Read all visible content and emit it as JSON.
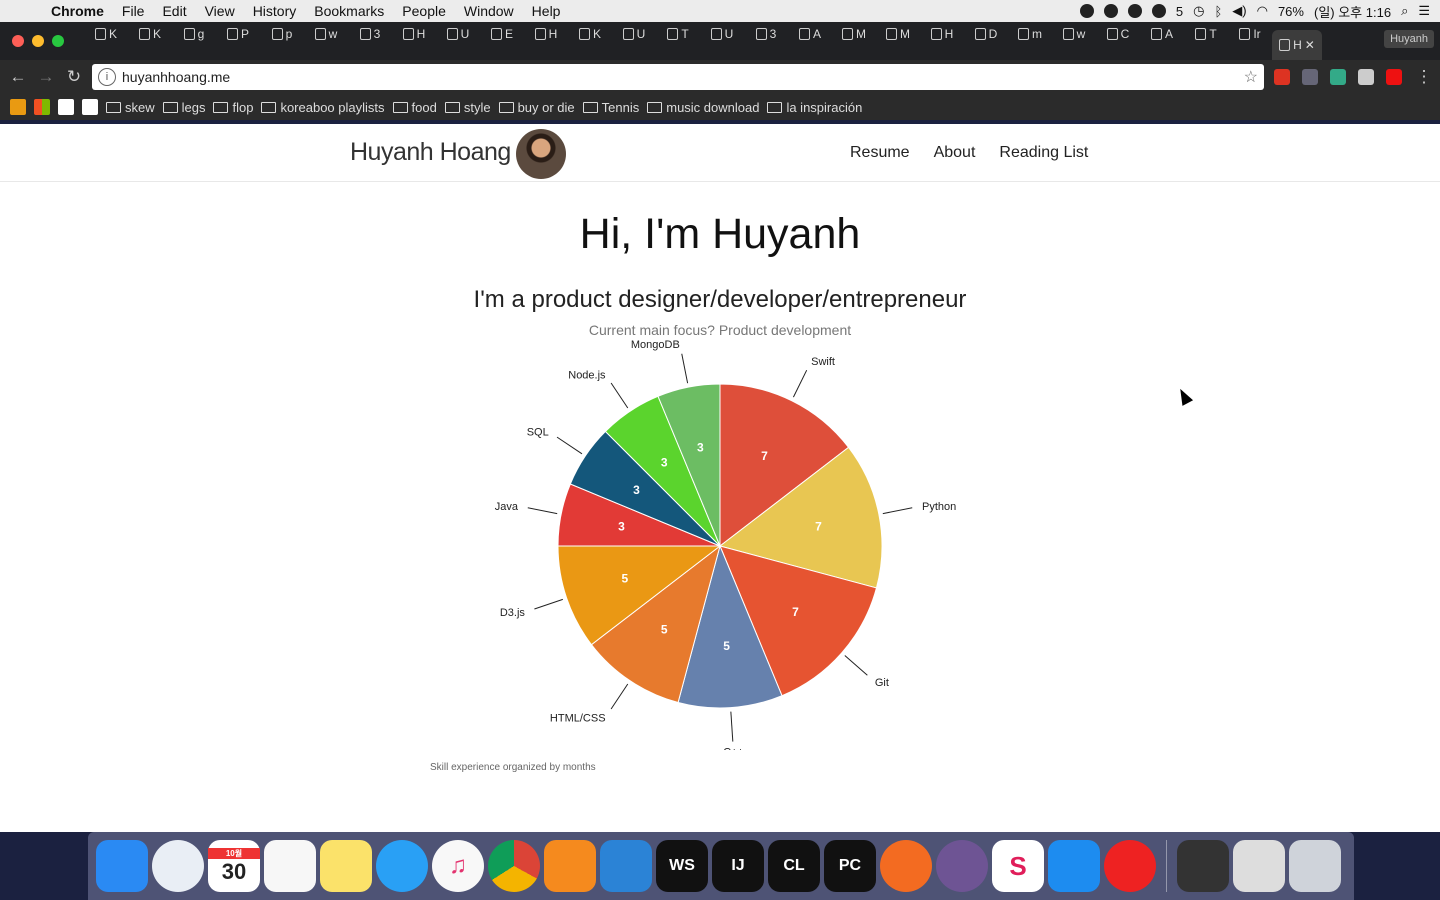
{
  "menubar": {
    "app": "Chrome",
    "items": [
      "File",
      "Edit",
      "View",
      "History",
      "Bookmarks",
      "People",
      "Window",
      "Help"
    ],
    "status": {
      "battery": "76%",
      "datetime": "(일) 오후 1:16",
      "notif": "5"
    }
  },
  "tabs": [
    "K",
    "K",
    "g",
    "P",
    "p",
    "w",
    "3",
    "H",
    "U",
    "E",
    "H",
    "K",
    "U",
    "T",
    "U",
    "3",
    "A",
    "M",
    "M",
    "H",
    "D",
    "m",
    "w",
    "C",
    "A",
    "T",
    "Ir",
    "H"
  ],
  "profile": "Huyanh",
  "address": {
    "url": "huyanhhoang.me"
  },
  "bookmarks": [
    "skew",
    "legs",
    "flop",
    "koreaboo playlists",
    "food",
    "style",
    "buy or die",
    "Tennis",
    "music download",
    "la inspiración"
  ],
  "site": {
    "brand": "Huyanh Hoang",
    "nav": [
      "Resume",
      "About",
      "Reading List"
    ],
    "greeting": "Hi, I'm Huyanh",
    "headline": "I'm a product designer/developer/entrepreneur",
    "focus": "Current main focus? Product development",
    "caption": "Skill experience organized by months"
  },
  "chart_data": {
    "type": "pie",
    "categories": [
      "Swift",
      "Python",
      "Git",
      "C++",
      "HTML/CSS",
      "D3.js",
      "Java",
      "SQL",
      "Node.js",
      "MongoDB"
    ],
    "values": [
      7,
      7,
      7,
      5,
      5,
      5,
      3,
      3,
      3,
      3
    ],
    "colors": [
      "#de4f3a",
      "#e8c652",
      "#e65431",
      "#6681ad",
      "#e77a2d",
      "#ea9814",
      "#e23a36",
      "#14577b",
      "#5bd42d",
      "#6cbd63"
    ],
    "title": "",
    "note": "Skill experience organized by months"
  },
  "dock": {
    "calendar_day": "30",
    "calendar_month": "10월"
  }
}
